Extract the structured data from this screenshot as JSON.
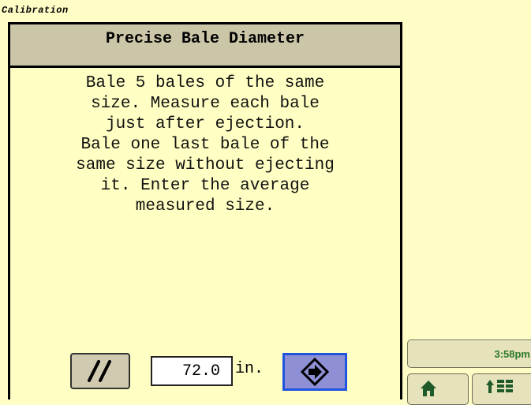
{
  "header": {
    "label": "Calibration"
  },
  "panel": {
    "title": "Precise Bale Diameter",
    "instructions": "Bale 5 bales of the same\nsize. Measure each bale\njust after ejection.\nBale one last bale of the\nsame size without ejecting\nit. Enter the average\nmeasured size."
  },
  "input": {
    "value": "72.0",
    "unit": "in."
  },
  "status": {
    "time": "3:58pm"
  },
  "icons": {
    "clear": "double-slash-icon",
    "enter": "arrow-right-diamond-icon",
    "home": "home-icon",
    "menu": "menu-grid-icon"
  },
  "colors": {
    "background": "#fffdc6",
    "title_bar": "#cbc6a8",
    "enter_button": "#8f8fd6",
    "enter_border": "#1f54e0",
    "clock_text": "#2c7a2c"
  }
}
